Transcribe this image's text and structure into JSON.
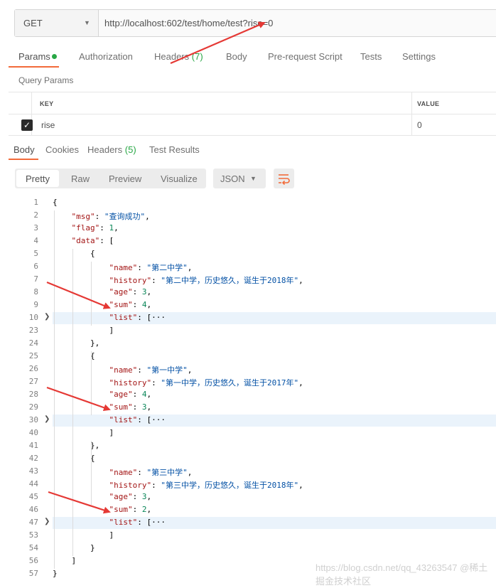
{
  "request": {
    "method": "GET",
    "url": "http://localhost:602/test/home/test?rise=0"
  },
  "request_tabs": [
    "Params",
    "Authorization",
    "Headers (7)",
    "Body",
    "Pre-request Script",
    "Tests",
    "Settings"
  ],
  "query_params": {
    "title": "Query Params",
    "columns": [
      "KEY",
      "VALUE"
    ],
    "rows": [
      {
        "key": "rise",
        "value": "0",
        "checked": true
      }
    ]
  },
  "response_tabs": [
    "Body",
    "Cookies",
    "Headers (5)",
    "Test Results"
  ],
  "view_modes": [
    "Pretty",
    "Raw",
    "Preview",
    "Visualize"
  ],
  "format": "JSON",
  "code_lines": [
    {
      "n": "1",
      "indent": 0,
      "parts": [
        [
          "p",
          "{"
        ]
      ]
    },
    {
      "n": "2",
      "indent": 1,
      "parts": [
        [
          "k",
          "\"msg\""
        ],
        [
          "p",
          ": "
        ],
        [
          "s",
          "\"查询成功\""
        ],
        [
          "p",
          ","
        ]
      ]
    },
    {
      "n": "3",
      "indent": 1,
      "parts": [
        [
          "k",
          "\"flag\""
        ],
        [
          "p",
          ": "
        ],
        [
          "n",
          "1"
        ],
        [
          "p",
          ","
        ]
      ]
    },
    {
      "n": "4",
      "indent": 1,
      "parts": [
        [
          "k",
          "\"data\""
        ],
        [
          "p",
          ": ["
        ]
      ]
    },
    {
      "n": "5",
      "indent": 2,
      "parts": [
        [
          "p",
          "{"
        ]
      ]
    },
    {
      "n": "6",
      "indent": 3,
      "parts": [
        [
          "k",
          "\"name\""
        ],
        [
          "p",
          ": "
        ],
        [
          "s",
          "\"第二中学\""
        ],
        [
          "p",
          ","
        ]
      ]
    },
    {
      "n": "7",
      "indent": 3,
      "parts": [
        [
          "k",
          "\"history\""
        ],
        [
          "p",
          ": "
        ],
        [
          "s",
          "\"第二中学，历史悠久，诞生于2018年\""
        ],
        [
          "p",
          ","
        ]
      ]
    },
    {
      "n": "8",
      "indent": 3,
      "parts": [
        [
          "k",
          "\"age\""
        ],
        [
          "p",
          ": "
        ],
        [
          "n",
          "3"
        ],
        [
          "p",
          ","
        ]
      ]
    },
    {
      "n": "9",
      "indent": 3,
      "parts": [
        [
          "k",
          "\"sum\""
        ],
        [
          "p",
          ": "
        ],
        [
          "n",
          "4"
        ],
        [
          "p",
          ","
        ]
      ]
    },
    {
      "n": "10",
      "indent": 3,
      "folded": true,
      "parts": [
        [
          "k",
          "\"list\""
        ],
        [
          "p",
          ": [···"
        ]
      ]
    },
    {
      "n": "23",
      "indent": 3,
      "parts": [
        [
          "p",
          "]"
        ]
      ]
    },
    {
      "n": "24",
      "indent": 2,
      "parts": [
        [
          "p",
          "},"
        ]
      ]
    },
    {
      "n": "25",
      "indent": 2,
      "parts": [
        [
          "p",
          "{"
        ]
      ]
    },
    {
      "n": "26",
      "indent": 3,
      "parts": [
        [
          "k",
          "\"name\""
        ],
        [
          "p",
          ": "
        ],
        [
          "s",
          "\"第一中学\""
        ],
        [
          "p",
          ","
        ]
      ]
    },
    {
      "n": "27",
      "indent": 3,
      "parts": [
        [
          "k",
          "\"history\""
        ],
        [
          "p",
          ": "
        ],
        [
          "s",
          "\"第一中学，历史悠久，诞生于2017年\""
        ],
        [
          "p",
          ","
        ]
      ]
    },
    {
      "n": "28",
      "indent": 3,
      "parts": [
        [
          "k",
          "\"age\""
        ],
        [
          "p",
          ": "
        ],
        [
          "n",
          "4"
        ],
        [
          "p",
          ","
        ]
      ]
    },
    {
      "n": "29",
      "indent": 3,
      "parts": [
        [
          "k",
          "\"sum\""
        ],
        [
          "p",
          ": "
        ],
        [
          "n",
          "3"
        ],
        [
          "p",
          ","
        ]
      ]
    },
    {
      "n": "30",
      "indent": 3,
      "folded": true,
      "parts": [
        [
          "k",
          "\"list\""
        ],
        [
          "p",
          ": [···"
        ]
      ]
    },
    {
      "n": "40",
      "indent": 3,
      "parts": [
        [
          "p",
          "]"
        ]
      ]
    },
    {
      "n": "41",
      "indent": 2,
      "parts": [
        [
          "p",
          "},"
        ]
      ]
    },
    {
      "n": "42",
      "indent": 2,
      "parts": [
        [
          "p",
          "{"
        ]
      ]
    },
    {
      "n": "43",
      "indent": 3,
      "parts": [
        [
          "k",
          "\"name\""
        ],
        [
          "p",
          ": "
        ],
        [
          "s",
          "\"第三中学\""
        ],
        [
          "p",
          ","
        ]
      ]
    },
    {
      "n": "44",
      "indent": 3,
      "parts": [
        [
          "k",
          "\"history\""
        ],
        [
          "p",
          ": "
        ],
        [
          "s",
          "\"第三中学，历史悠久，诞生于2018年\""
        ],
        [
          "p",
          ","
        ]
      ]
    },
    {
      "n": "45",
      "indent": 3,
      "parts": [
        [
          "k",
          "\"age\""
        ],
        [
          "p",
          ": "
        ],
        [
          "n",
          "3"
        ],
        [
          "p",
          ","
        ]
      ]
    },
    {
      "n": "46",
      "indent": 3,
      "parts": [
        [
          "k",
          "\"sum\""
        ],
        [
          "p",
          ": "
        ],
        [
          "n",
          "2"
        ],
        [
          "p",
          ","
        ]
      ]
    },
    {
      "n": "47",
      "indent": 3,
      "folded": true,
      "parts": [
        [
          "k",
          "\"list\""
        ],
        [
          "p",
          ": [···"
        ]
      ]
    },
    {
      "n": "53",
      "indent": 3,
      "parts": [
        [
          "p",
          "]"
        ]
      ]
    },
    {
      "n": "54",
      "indent": 2,
      "parts": [
        [
          "p",
          "}"
        ]
      ]
    },
    {
      "n": "56",
      "indent": 1,
      "parts": [
        [
          "p",
          "]"
        ]
      ]
    },
    {
      "n": "57",
      "indent": 0,
      "parts": [
        [
          "p",
          "}"
        ]
      ]
    }
  ],
  "watermark": "https://blog.csdn.net/qq_43263547  @稀土掘金技术社区",
  "colors": {
    "accent": "#f26b3a",
    "annotation_arrow": "#e53935",
    "json_key": "#a31515",
    "json_string": "#0451a5",
    "json_number": "#098658"
  }
}
